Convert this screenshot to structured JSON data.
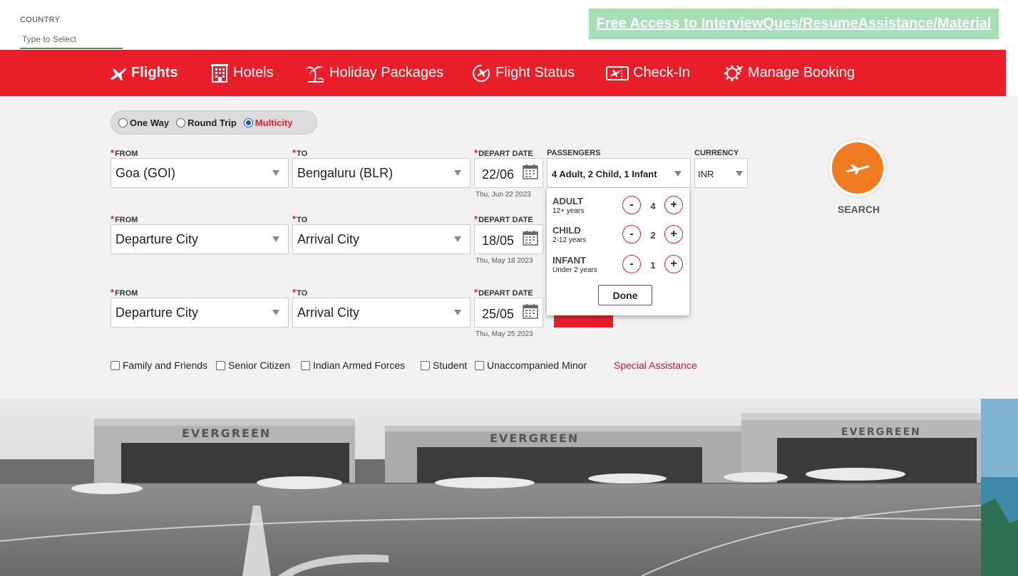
{
  "country": {
    "label": "COUNTRY",
    "placeholder": "Type to Select"
  },
  "promo": {
    "text": "Free Access to InterviewQues/ResumeAssistance/Material"
  },
  "nav": {
    "flights": "Flights",
    "hotels": "Hotels",
    "holiday": "Holiday Packages",
    "status": "Flight Status",
    "checkin": "Check-In",
    "manage": "Manage Booking"
  },
  "trip": {
    "one_way": "One Way",
    "round_trip": "Round Trip",
    "multicity": "Multicity",
    "selected": "Multicity"
  },
  "labels": {
    "from": "FROM",
    "to": "TO",
    "depart": "DEPART DATE",
    "passengers": "PASSENGERS",
    "currency": "CURRENCY",
    "required": "*"
  },
  "legs": [
    {
      "from": "Goa (GOI)",
      "to": "Bengaluru (BLR)",
      "date": "22/06",
      "date_full": "Thu, Jun 22 2023"
    },
    {
      "from": "Departure City",
      "to": "Arrival City",
      "date": "18/05",
      "date_full": "Thu, May 18 2023"
    },
    {
      "from": "Departure City",
      "to": "Arrival City",
      "date": "25/05",
      "date_full": "Thu, May 25 2023"
    }
  ],
  "passengers": {
    "summary": "4 Adult, 2 Child, 1 Infant",
    "adult": {
      "name": "ADULT",
      "age": "12+ years",
      "count": "4"
    },
    "child": {
      "name": "CHILD",
      "age": "2-12 years",
      "count": "2"
    },
    "infant": {
      "name": "INFANT",
      "age": "Under 2 years",
      "count": "1"
    },
    "minus": "-",
    "plus": "+",
    "done": "Done"
  },
  "currency": {
    "value": "INR"
  },
  "search": {
    "label": "SEARCH"
  },
  "options": {
    "family": "Family and Friends",
    "senior": "Senior Citizen",
    "armed": "Indian Armed Forces",
    "student": "Student",
    "minor": "Unaccompanied Minor",
    "special": "Special Assistance"
  },
  "banner": {
    "hangar_text": "EVERGREEN"
  },
  "colors": {
    "brand_red": "#e91e29",
    "search_orange": "#f17b21",
    "promo_green": "#a6dfb5",
    "panel_bg": "#f2f2f2"
  }
}
